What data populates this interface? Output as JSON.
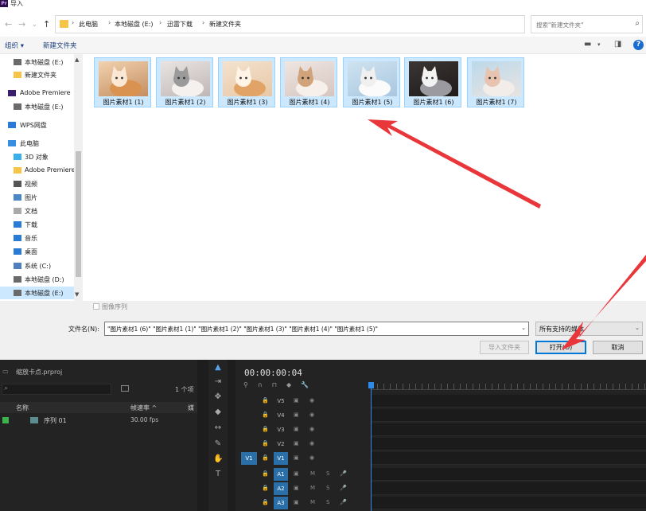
{
  "window": {
    "title": "导入",
    "app_badge": "Pr"
  },
  "breadcrumb": [
    "此电脑",
    "本地磁盘 (E:)",
    "迅雷下载",
    "新建文件夹"
  ],
  "search": {
    "placeholder": "搜索\"新建文件夹\""
  },
  "toolbar": {
    "organize": "组织 ▾",
    "new_folder": "新建文件夹"
  },
  "nav": {
    "items": [
      {
        "label": "本地磁盘 (E:)",
        "icon": "drive-icon",
        "selected": false
      },
      {
        "label": "新建文件夹",
        "icon": "folder-icon",
        "selected": false
      },
      {
        "label": "Adobe Premiere",
        "icon": "premiere-icon",
        "selected": false,
        "top": true
      },
      {
        "label": "本地磁盘 (E:)",
        "icon": "drive-icon",
        "selected": false
      },
      {
        "label": "WPS网盘",
        "icon": "cloud-icon",
        "selected": false,
        "top": true
      },
      {
        "label": "此电脑",
        "icon": "computer-icon",
        "selected": false,
        "top": true
      },
      {
        "label": "3D 对象",
        "icon": "3d-objects-icon",
        "selected": false
      },
      {
        "label": "Adobe Premiere",
        "icon": "folder-icon",
        "selected": false
      },
      {
        "label": "视频",
        "icon": "video-icon",
        "selected": false
      },
      {
        "label": "图片",
        "icon": "pictures-icon",
        "selected": false
      },
      {
        "label": "文档",
        "icon": "documents-icon",
        "selected": false
      },
      {
        "label": "下载",
        "icon": "download-icon",
        "selected": false
      },
      {
        "label": "音乐",
        "icon": "music-icon",
        "selected": false
      },
      {
        "label": "桌面",
        "icon": "desktop-icon",
        "selected": false
      },
      {
        "label": "系统 (C:)",
        "icon": "system-drive-icon",
        "selected": false
      },
      {
        "label": "本地磁盘 (D:)",
        "icon": "drive-icon",
        "selected": false
      },
      {
        "label": "本地磁盘 (E:)",
        "icon": "drive-icon",
        "selected": true
      }
    ]
  },
  "files": [
    {
      "label": "图片素材1 (1)"
    },
    {
      "label": "图片素材1 (2)"
    },
    {
      "label": "图片素材1 (3)"
    },
    {
      "label": "图片素材1 (4)"
    },
    {
      "label": "图片素材1 (5)"
    },
    {
      "label": "图片素材1 (6)"
    },
    {
      "label": "图片素材1 (7)"
    }
  ],
  "image_sequence": {
    "label": "图像序列",
    "checked": false
  },
  "filename": {
    "label": "文件名(N):",
    "value": "\"图片素材1 (6)\" \"图片素材1 (1)\" \"图片素材1 (2)\" \"图片素材1 (3)\" \"图片素材1 (4)\" \"图片素材1 (5)\""
  },
  "filetype": {
    "value": "所有支持的媒体"
  },
  "buttons": {
    "import_folder": "导入文件夹",
    "open": "打开(O)",
    "cancel": "取消"
  },
  "project": {
    "name": "缩放卡点.prproj",
    "item_count": "1 个项",
    "columns": {
      "name": "名称",
      "fps": "帧速率 ^",
      "media": "媒"
    },
    "rows": [
      {
        "name": "序列 01",
        "fps": "30.00 fps"
      }
    ]
  },
  "timeline": {
    "timecode": "00:00:00:04",
    "video_tracks": [
      "V5",
      "V4",
      "V3",
      "V2",
      "V1"
    ],
    "audio_tracks": [
      "A1",
      "A2",
      "A3"
    ],
    "source_patch": "V1"
  },
  "colors": {
    "selection": "#cce8ff",
    "accent": "#2a6fa8",
    "annotation_arrow": "#e8363a"
  }
}
